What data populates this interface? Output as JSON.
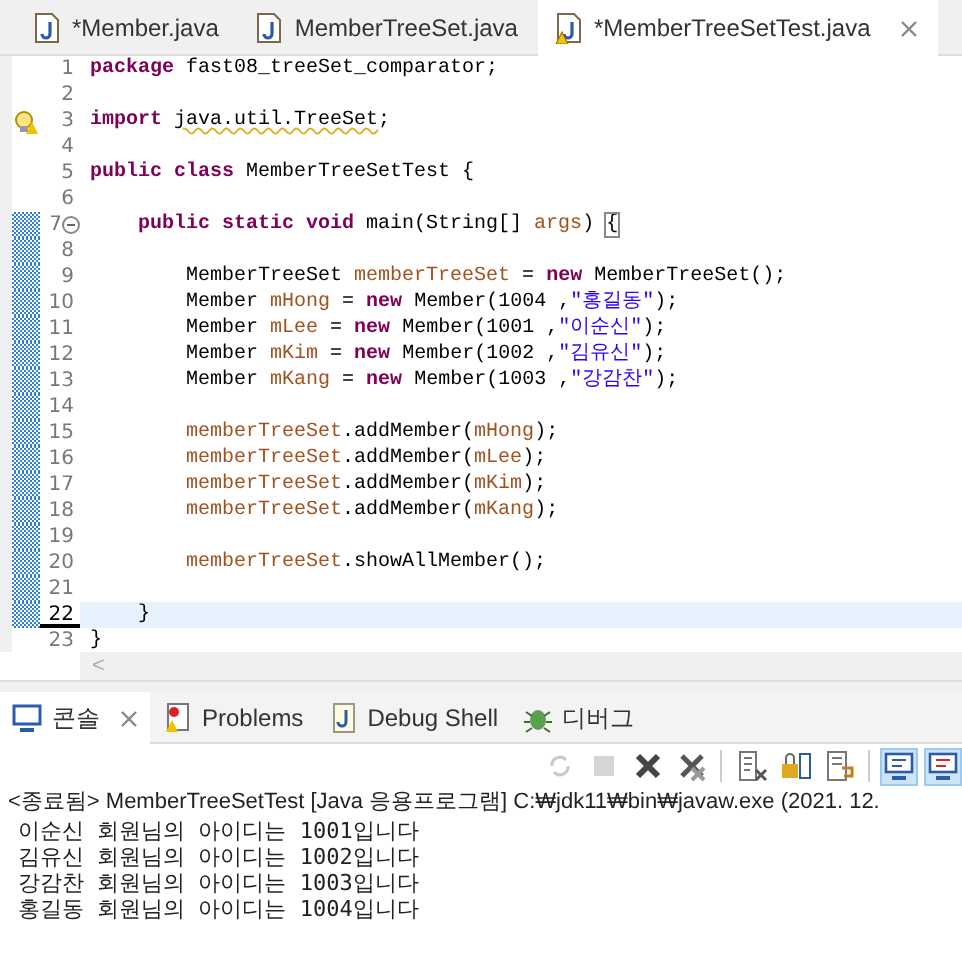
{
  "editor_tabs": [
    {
      "label": "*Member.java",
      "selected": false,
      "warning": false,
      "closable": false
    },
    {
      "label": "MemberTreeSet.java",
      "selected": false,
      "warning": false,
      "closable": false
    },
    {
      "label": "*MemberTreeSetTest.java",
      "selected": true,
      "warning": true,
      "closable": true
    }
  ],
  "code_lines": [
    {
      "number": "1",
      "changed": false,
      "current": false,
      "tokens": [
        {
          "kind": "kw",
          "text": "package"
        },
        {
          "kind": "plain",
          "text": " fast08_treeSet_comparator;"
        }
      ]
    },
    {
      "number": "2",
      "changed": false,
      "current": false
    },
    {
      "number": "3",
      "changed": false,
      "current": false,
      "warning": true,
      "tokens": [
        {
          "kind": "kw",
          "text": "import "
        },
        {
          "kind": "warn",
          "text": "java.util.TreeSet"
        },
        {
          "kind": "plain",
          "text": ";"
        }
      ]
    },
    {
      "number": "4",
      "changed": false,
      "current": false
    },
    {
      "number": "5",
      "changed": false,
      "current": false,
      "tokens": [
        {
          "kind": "kw",
          "text": "public class"
        },
        {
          "kind": "plain",
          "text": " MemberTreeSetTest {"
        }
      ]
    },
    {
      "number": "6",
      "changed": false,
      "current": false
    },
    {
      "number": "7",
      "changed": true,
      "current": false,
      "foldable": true,
      "tokens": [
        {
          "kind": "kw",
          "text": "    public static void"
        },
        {
          "kind": "plain",
          "text": " main(String[] "
        },
        {
          "kind": "var",
          "text": "args"
        },
        {
          "kind": "plain",
          "text": ") "
        },
        {
          "kind": "bracket",
          "text": "{"
        }
      ]
    },
    {
      "number": "8",
      "changed": true,
      "current": false
    },
    {
      "number": "9",
      "changed": true,
      "current": false,
      "tokens": [
        {
          "kind": "plain",
          "text": "        MemberTreeSet "
        },
        {
          "kind": "var",
          "text": "memberTreeSet"
        },
        {
          "kind": "plain",
          "text": " = "
        },
        {
          "kind": "kw",
          "text": "new"
        },
        {
          "kind": "plain",
          "text": " MemberTreeSet();"
        }
      ]
    },
    {
      "number": "10",
      "changed": true,
      "current": false,
      "tokens": [
        {
          "kind": "plain",
          "text": "        Member "
        },
        {
          "kind": "var",
          "text": "mHong"
        },
        {
          "kind": "plain",
          "text": " = "
        },
        {
          "kind": "kw",
          "text": "new"
        },
        {
          "kind": "plain",
          "text": " Member(1004 ,"
        },
        {
          "kind": "str",
          "text": "\"홍길동\""
        },
        {
          "kind": "plain",
          "text": ");"
        }
      ]
    },
    {
      "number": "11",
      "changed": true,
      "current": false,
      "tokens": [
        {
          "kind": "plain",
          "text": "        Member "
        },
        {
          "kind": "var",
          "text": "mLee"
        },
        {
          "kind": "plain",
          "text": " = "
        },
        {
          "kind": "kw",
          "text": "new"
        },
        {
          "kind": "plain",
          "text": " Member(1001 ,"
        },
        {
          "kind": "str",
          "text": "\"이순신\""
        },
        {
          "kind": "plain",
          "text": ");"
        }
      ]
    },
    {
      "number": "12",
      "changed": true,
      "current": false,
      "tokens": [
        {
          "kind": "plain",
          "text": "        Member "
        },
        {
          "kind": "var",
          "text": "mKim"
        },
        {
          "kind": "plain",
          "text": " = "
        },
        {
          "kind": "kw",
          "text": "new"
        },
        {
          "kind": "plain",
          "text": " Member(1002 ,"
        },
        {
          "kind": "str",
          "text": "\"김유신\""
        },
        {
          "kind": "plain",
          "text": ");"
        }
      ]
    },
    {
      "number": "13",
      "changed": true,
      "current": false,
      "tokens": [
        {
          "kind": "plain",
          "text": "        Member "
        },
        {
          "kind": "var",
          "text": "mKang"
        },
        {
          "kind": "plain",
          "text": " = "
        },
        {
          "kind": "kw",
          "text": "new"
        },
        {
          "kind": "plain",
          "text": " Member(1003 ,"
        },
        {
          "kind": "str",
          "text": "\"강감찬\""
        },
        {
          "kind": "plain",
          "text": ");"
        }
      ]
    },
    {
      "number": "14",
      "changed": true,
      "current": false
    },
    {
      "number": "15",
      "changed": true,
      "current": false,
      "tokens": [
        {
          "kind": "var",
          "text": "        memberTreeSet"
        },
        {
          "kind": "plain",
          "text": ".addMember("
        },
        {
          "kind": "var",
          "text": "mHong"
        },
        {
          "kind": "plain",
          "text": ");"
        }
      ]
    },
    {
      "number": "16",
      "changed": true,
      "current": false,
      "tokens": [
        {
          "kind": "var",
          "text": "        memberTreeSet"
        },
        {
          "kind": "plain",
          "text": ".addMember("
        },
        {
          "kind": "var",
          "text": "mLee"
        },
        {
          "kind": "plain",
          "text": ");"
        }
      ]
    },
    {
      "number": "17",
      "changed": true,
      "current": false,
      "tokens": [
        {
          "kind": "var",
          "text": "        memberTreeSet"
        },
        {
          "kind": "plain",
          "text": ".addMember("
        },
        {
          "kind": "var",
          "text": "mKim"
        },
        {
          "kind": "plain",
          "text": ");"
        }
      ]
    },
    {
      "number": "18",
      "changed": true,
      "current": false,
      "tokens": [
        {
          "kind": "var",
          "text": "        memberTreeSet"
        },
        {
          "kind": "plain",
          "text": ".addMember("
        },
        {
          "kind": "var",
          "text": "mKang"
        },
        {
          "kind": "plain",
          "text": ");"
        }
      ]
    },
    {
      "number": "19",
      "changed": true,
      "current": false
    },
    {
      "number": "20",
      "changed": true,
      "current": false,
      "tokens": [
        {
          "kind": "var",
          "text": "        memberTreeSet"
        },
        {
          "kind": "plain",
          "text": ".showAllMember();"
        }
      ]
    },
    {
      "number": "21",
      "changed": true,
      "current": false
    },
    {
      "number": "22",
      "changed": true,
      "current": true,
      "tokens": [
        {
          "kind": "plain",
          "text": "    }"
        }
      ]
    },
    {
      "number": "23",
      "changed": false,
      "current": false,
      "tokens": [
        {
          "kind": "plain",
          "text": "}"
        }
      ]
    }
  ],
  "scroll_arrow": "<",
  "panel_tabs": [
    {
      "label": "콘솔",
      "kind": "console",
      "selected": true,
      "closable": true
    },
    {
      "label": "Problems",
      "kind": "problems",
      "selected": false,
      "closable": false
    },
    {
      "label": "Debug Shell",
      "kind": "shell",
      "selected": false,
      "closable": false
    },
    {
      "label": "디버그",
      "kind": "debug",
      "selected": false,
      "closable": false
    }
  ],
  "toolbar": [
    {
      "kind": "relaunch",
      "disabled": true,
      "pressed": false
    },
    {
      "kind": "stop",
      "disabled": true,
      "pressed": false
    },
    {
      "kind": "remove",
      "disabled": false,
      "pressed": false
    },
    {
      "kind": "remove-all",
      "disabled": false,
      "pressed": false
    },
    {
      "kind": "clear",
      "disabled": false,
      "pressed": false
    },
    {
      "kind": "scroll-lock",
      "disabled": false,
      "pressed": false
    },
    {
      "kind": "word-wrap",
      "disabled": false,
      "pressed": false
    },
    {
      "kind": "show-out",
      "disabled": false,
      "pressed": true
    },
    {
      "kind": "show-err",
      "disabled": false,
      "pressed": true
    }
  ],
  "console": {
    "header": "<종료됨> MemberTreeSetTest [Java 응용프로그램] C:₩jdk11₩bin₩javaw.exe (2021. 12.",
    "output": [
      "이순신 회원님의 아이디는 1001입니다",
      "김유신 회원님의 아이디는 1002입니다",
      "강감찬 회원님의 아이디는 1003입니다",
      "홍길동 회원님의 아이디는 1004입니다"
    ]
  }
}
